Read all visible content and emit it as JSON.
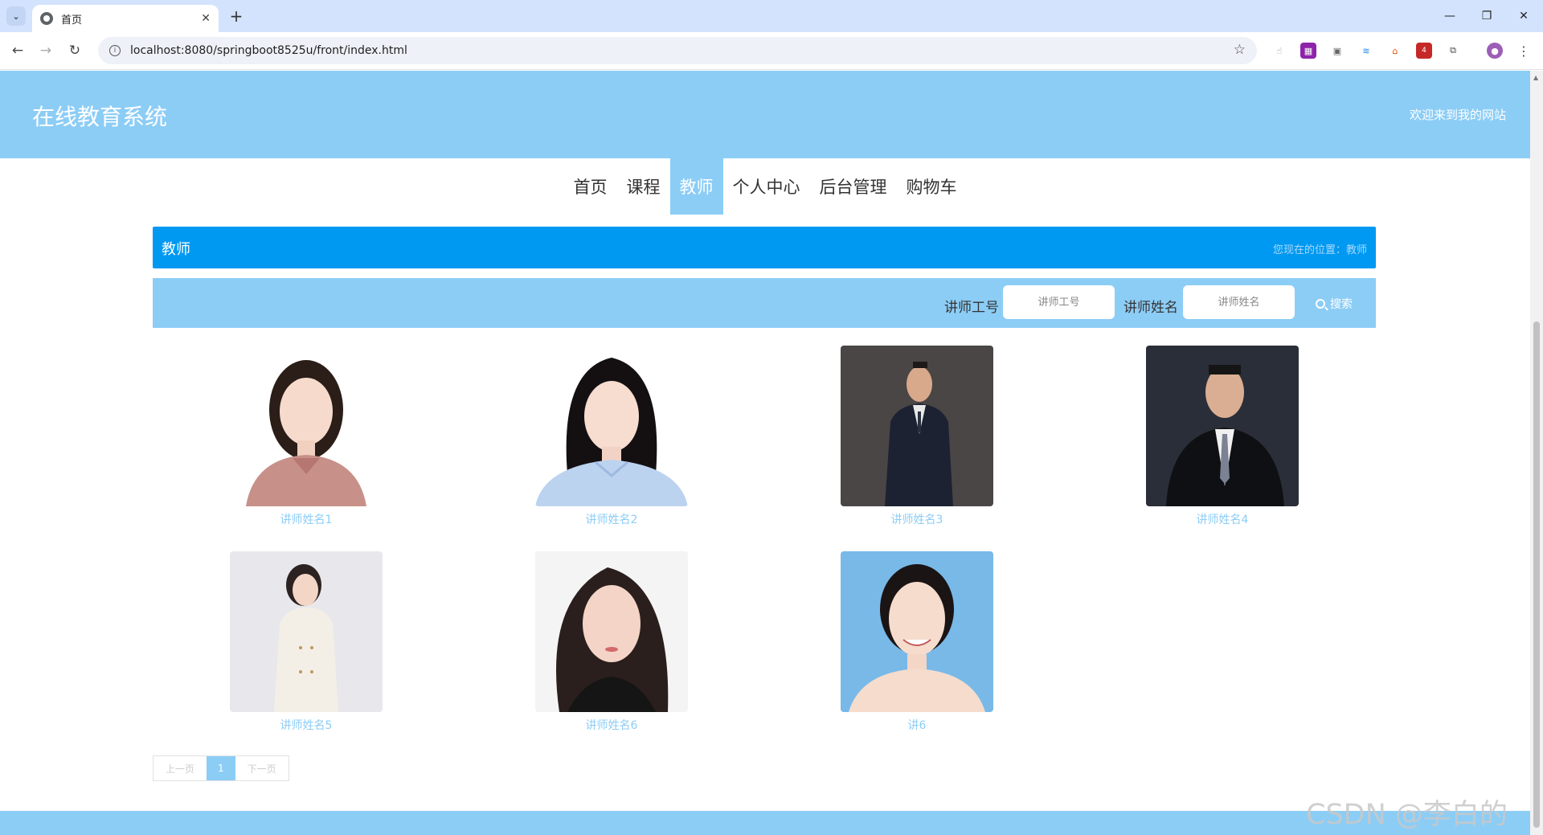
{
  "browser": {
    "tab_title": "首页",
    "url": "localhost:8080/springboot8525u/front/index.html",
    "extension_badge": "4"
  },
  "site": {
    "title": "在线教育系统",
    "welcome": "欢迎来到我的网站"
  },
  "nav": {
    "items": [
      "首页",
      "课程",
      "教师",
      "个人中心",
      "后台管理",
      "购物车"
    ],
    "active": "教师"
  },
  "section": {
    "title": "教师",
    "breadcrumb": "您现在的位置：教师"
  },
  "search": {
    "id_label": "讲师工号",
    "id_placeholder": "讲师工号",
    "name_label": "讲师姓名",
    "name_placeholder": "讲师姓名",
    "button": "搜索"
  },
  "teachers": [
    {
      "name": "讲师姓名1"
    },
    {
      "name": "讲师姓名2"
    },
    {
      "name": "讲师姓名3"
    },
    {
      "name": "讲师姓名4"
    },
    {
      "name": "讲师姓名5"
    },
    {
      "name": "讲师姓名6"
    },
    {
      "name": "讲6"
    }
  ],
  "pagination": {
    "prev": "上一页",
    "current": "1",
    "next": "下一页"
  },
  "watermark": "CSDN @李白的粉",
  "colors": {
    "header": "#8ccdf6",
    "titlebar": "#0099f2"
  }
}
